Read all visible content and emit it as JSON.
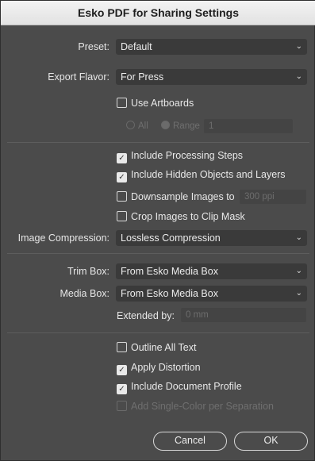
{
  "window": {
    "title": "Esko PDF for Sharing Settings"
  },
  "preset": {
    "label": "Preset:",
    "value": "Default"
  },
  "export_flavor": {
    "label": "Export Flavor:",
    "value": "For Press"
  },
  "use_artboards": {
    "label": "Use Artboards",
    "checked": false
  },
  "artboards": {
    "all_label": "All",
    "range_label": "Range",
    "range_value": "1"
  },
  "processing": {
    "label": "Include Processing Steps",
    "checked": true
  },
  "hidden_objects": {
    "label": "Include Hidden Objects and Layers",
    "checked": true
  },
  "downsample": {
    "label": "Downsample Images to",
    "checked": false,
    "value": "300 ppi"
  },
  "crop_images": {
    "label": "Crop Images to Clip Mask",
    "checked": false
  },
  "image_compression": {
    "label": "Image Compression:",
    "value": "Lossless Compression"
  },
  "trim_box": {
    "label": "Trim Box:",
    "value": "From Esko Media Box"
  },
  "media_box": {
    "label": "Media Box:",
    "value": "From Esko Media Box"
  },
  "extended_by": {
    "label": "Extended by:",
    "value": "0 mm"
  },
  "outline_text": {
    "label": "Outline All Text",
    "checked": false
  },
  "apply_distortion": {
    "label": "Apply Distortion",
    "checked": true
  },
  "include_profile": {
    "label": "Include Document Profile",
    "checked": true
  },
  "single_color": {
    "label": "Add Single-Color per Separation",
    "checked": false
  },
  "buttons": {
    "cancel": "Cancel",
    "ok": "OK"
  },
  "icons": {
    "dropdown": "chevron-down-icon",
    "check": "checkmark-icon"
  }
}
